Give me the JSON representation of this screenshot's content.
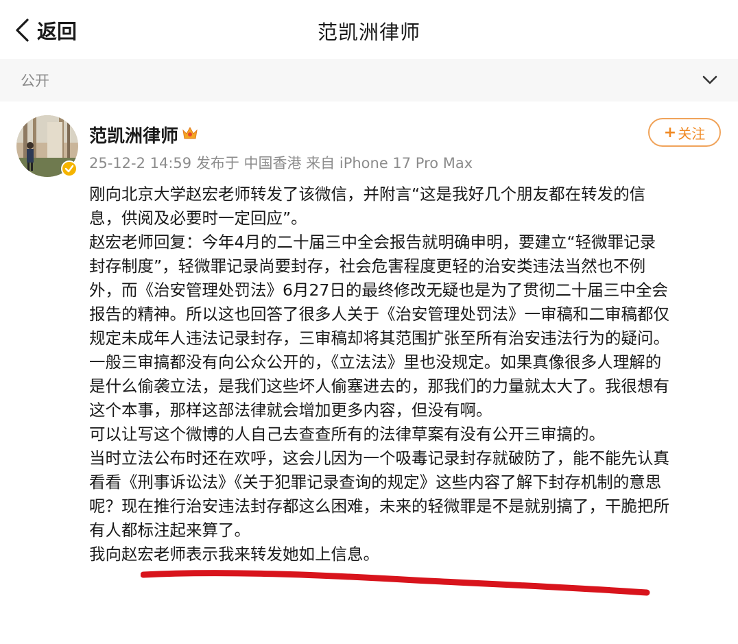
{
  "nav": {
    "back_label": "返回",
    "title": "范凯洲律师"
  },
  "visibility": {
    "label": "公开"
  },
  "post": {
    "author": "范凯洲律师",
    "meta": "25-12-2 14:59 发布于 中国香港 来自 iPhone 17 Pro Max",
    "follow_label": "关注",
    "body_lines": [
      "刚向北京大学赵宏老师转发了该微信，并附言“这是我好几个朋友都在转发的信",
      "息，供阅及必要时一定回应”。",
      "赵宏老师回复：今年4月的二十届三中全会报告就明确申明，要建立“轻微罪记录",
      "封存制度”，轻微罪记录尚要封存，社会危害程度更轻的治安类违法当然也不例",
      "外，而《治安管理处罚法》6月27日的最终修改无疑也是为了贯彻二十届三中全会",
      "报告的精神。所以这也回答了很多人关于《治安管理处罚法》一审稿和二审稿都仅",
      "规定未成年人违法记录封存，三审稿却将其范围扩张至所有治安违法行为的疑问。",
      "一般三审搞都没有向公众公开的，《立法法》里也没规定。如果真像很多人理解的",
      "是什么偷袭立法，是我们这些坏人偷塞进去的，那我们的力量就太大了。我很想有",
      "这个本事，那样这部法律就会增加更多内容，但没有啊。",
      "可以让写这个微博的人自己去查查所有的法律草案有没有公开三审搞的。",
      "当时立法公布时还在欢呼，这会儿因为一个吸毒记录封存就破防了，能不能先认真",
      "看看《刑事诉讼法》《关于犯罪记录查询的规定》这些内容了解下封存机制的意思",
      "呢？现在推行治安违法封存都这么困难，未来的轻微罪是不是就别搞了，干脆把所",
      "有人都标注起来算了。",
      "我向赵宏老师表示我来转发她如上信息。"
    ]
  },
  "colors": {
    "follow_accent": "#f08a24",
    "underline_mark": "#d8141c",
    "verified_badge": "#f5b400"
  },
  "icons": {
    "back": "chevron-left-icon",
    "visibility_toggle": "chevron-down-icon",
    "verified": "verified-badge-icon",
    "member": "crown-icon"
  }
}
